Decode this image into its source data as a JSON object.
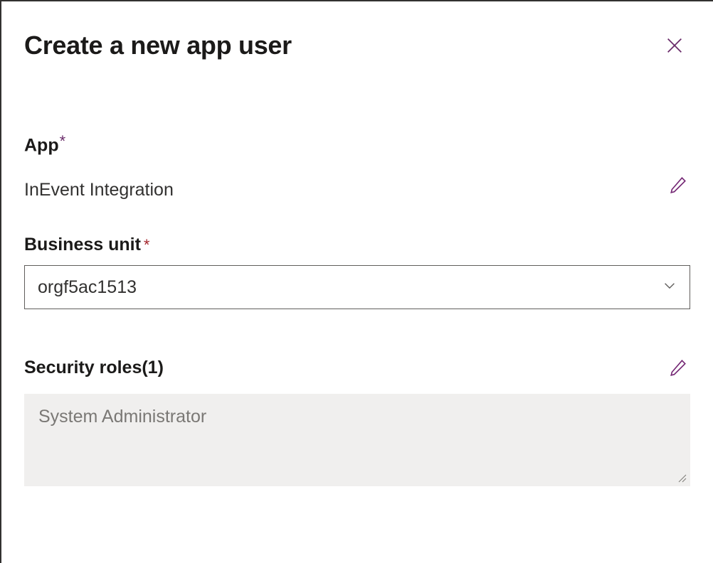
{
  "header": {
    "title": "Create a new app user"
  },
  "app": {
    "label": "App",
    "value": "InEvent Integration"
  },
  "businessUnit": {
    "label": "Business unit",
    "value": "orgf5ac1513"
  },
  "securityRoles": {
    "label": "Security roles(1)",
    "value": "System Administrator"
  }
}
